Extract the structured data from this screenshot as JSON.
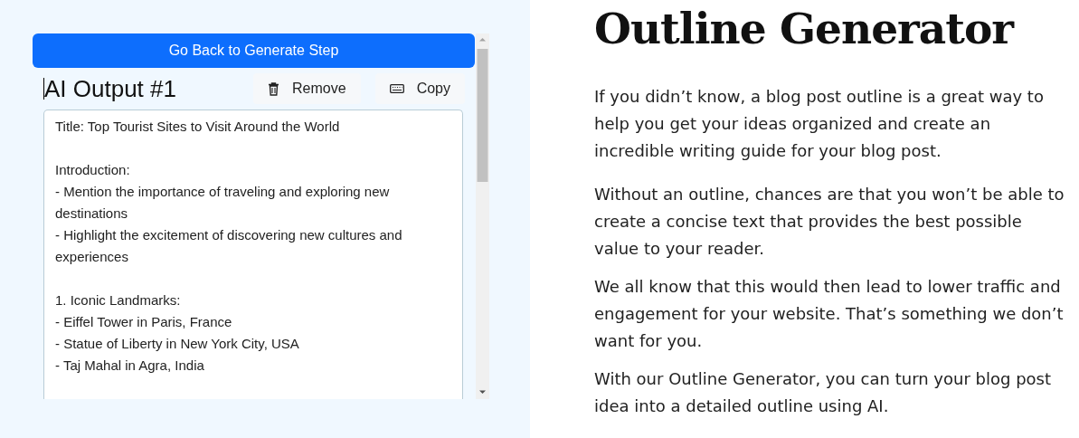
{
  "back_button": {
    "label": "Go Back to Generate Step"
  },
  "output": {
    "title": "AI Output #1",
    "actions": [
      {
        "kind": "remove",
        "label": "Remove"
      },
      {
        "kind": "copy",
        "label": "Copy"
      }
    ],
    "sections": [
      {
        "lines": [
          "Title: Top Tourist Sites to Visit Around the World"
        ]
      },
      {
        "lines": [
          "Introduction:",
          "- Mention the importance of traveling and exploring new destinations",
          "- Highlight the excitement of discovering new cultures and experiences"
        ]
      },
      {
        "lines": [
          "1. Iconic Landmarks:",
          "- Eiffel Tower in Paris, France",
          "- Statue of Liberty in New York City, USA",
          "- Taj Mahal in Agra, India"
        ]
      }
    ]
  },
  "article": {
    "heading": "Outline Generator",
    "paragraphs": [
      "If you didn’t know, a blog post outline is a great way to help you get your ideas organized and create an incredible writing guide for your blog post.",
      "Without an outline, chances are that you won’t be able to create a concise text that provides the best possible value to your reader.",
      "We all know that this would then lead to lower traffic and engagement for your website. That’s something we don’t want for you.",
      "With our Outline Generator, you can turn your blog post idea into a detailed outline using AI."
    ]
  }
}
